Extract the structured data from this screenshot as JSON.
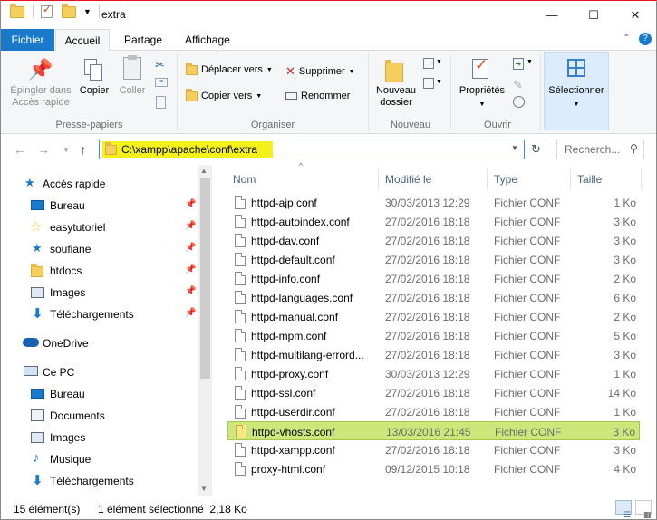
{
  "window": {
    "title": "extra",
    "minimize": "—",
    "maximize": "☐",
    "close": "✕"
  },
  "ribbon_tabs": [
    "Fichier",
    "Accueil",
    "Partage",
    "Affichage"
  ],
  "ribbon": {
    "clipboard": {
      "pin_label": "Épingler dans\nAccès rapide",
      "copy": "Copier",
      "paste": "Coller",
      "group": "Presse-papiers"
    },
    "organize": {
      "move": "Déplacer vers",
      "copy_to": "Copier vers",
      "delete": "Supprimer",
      "rename": "Renommer",
      "group": "Organiser"
    },
    "new": {
      "new_folder": "Nouveau\ndossier",
      "group": "Nouveau"
    },
    "open": {
      "properties": "Propriétés",
      "group": "Ouvrir"
    },
    "select": {
      "label": "Sélectionner"
    }
  },
  "address": {
    "path": "C:\\xampp\\apache\\conf\\extra",
    "search_placeholder": "Recherch..."
  },
  "nav": {
    "quick_access": "Accès rapide",
    "items": [
      {
        "label": "Bureau",
        "icon": "desktop-icon",
        "pinned": true
      },
      {
        "label": "easytutoriel",
        "icon": "star-icon",
        "pinned": true
      },
      {
        "label": "soufiane",
        "icon": "star-icon",
        "pinned": true
      },
      {
        "label": "htdocs",
        "icon": "folder-icon",
        "pinned": true
      },
      {
        "label": "Images",
        "icon": "pictures-icon",
        "pinned": true
      },
      {
        "label": "Téléchargements",
        "icon": "download-icon",
        "pinned": true
      }
    ],
    "onedrive": "OneDrive",
    "this_pc": "Ce PC",
    "pc_items": [
      {
        "label": "Bureau",
        "icon": "desktop-icon"
      },
      {
        "label": "Documents",
        "icon": "documents-icon"
      },
      {
        "label": "Images",
        "icon": "pictures-icon"
      },
      {
        "label": "Musique",
        "icon": "music-icon"
      },
      {
        "label": "Téléchargements",
        "icon": "download-icon"
      }
    ]
  },
  "columns": {
    "name": "Nom",
    "modified": "Modifié le",
    "type": "Type",
    "size": "Taille"
  },
  "files": [
    {
      "name": "httpd-ajp.conf",
      "date": "30/03/2013 12:29",
      "type": "Fichier CONF",
      "size": "1 Ko"
    },
    {
      "name": "httpd-autoindex.conf",
      "date": "27/02/2016 18:18",
      "type": "Fichier CONF",
      "size": "3 Ko"
    },
    {
      "name": "httpd-dav.conf",
      "date": "27/02/2016 18:18",
      "type": "Fichier CONF",
      "size": "3 Ko"
    },
    {
      "name": "httpd-default.conf",
      "date": "27/02/2016 18:18",
      "type": "Fichier CONF",
      "size": "3 Ko"
    },
    {
      "name": "httpd-info.conf",
      "date": "27/02/2016 18:18",
      "type": "Fichier CONF",
      "size": "2 Ko"
    },
    {
      "name": "httpd-languages.conf",
      "date": "27/02/2016 18:18",
      "type": "Fichier CONF",
      "size": "6 Ko"
    },
    {
      "name": "httpd-manual.conf",
      "date": "27/02/2016 18:18",
      "type": "Fichier CONF",
      "size": "2 Ko"
    },
    {
      "name": "httpd-mpm.conf",
      "date": "27/02/2016 18:18",
      "type": "Fichier CONF",
      "size": "5 Ko"
    },
    {
      "name": "httpd-multilang-errord...",
      "date": "27/02/2016 18:18",
      "type": "Fichier CONF",
      "size": "3 Ko"
    },
    {
      "name": "httpd-proxy.conf",
      "date": "30/03/2013 12:29",
      "type": "Fichier CONF",
      "size": "1 Ko"
    },
    {
      "name": "httpd-ssl.conf",
      "date": "27/02/2016 18:18",
      "type": "Fichier CONF",
      "size": "14 Ko"
    },
    {
      "name": "httpd-userdir.conf",
      "date": "27/02/2016 18:18",
      "type": "Fichier CONF",
      "size": "1 Ko"
    },
    {
      "name": "httpd-vhosts.conf",
      "date": "13/03/2016 21:45",
      "type": "Fichier CONF",
      "size": "3 Ko",
      "selected": true
    },
    {
      "name": "httpd-xampp.conf",
      "date": "27/02/2016 18:18",
      "type": "Fichier CONF",
      "size": "3 Ko"
    },
    {
      "name": "proxy-html.conf",
      "date": "09/12/2015 10:18",
      "type": "Fichier CONF",
      "size": "4 Ko"
    }
  ],
  "status": {
    "count": "15 élément(s)",
    "selected": "1 élément sélectionné  2,18 Ko"
  },
  "colors": {
    "accent": "#1979ca",
    "selection": "#cde77b",
    "address_highlight": "#f2f21a"
  }
}
